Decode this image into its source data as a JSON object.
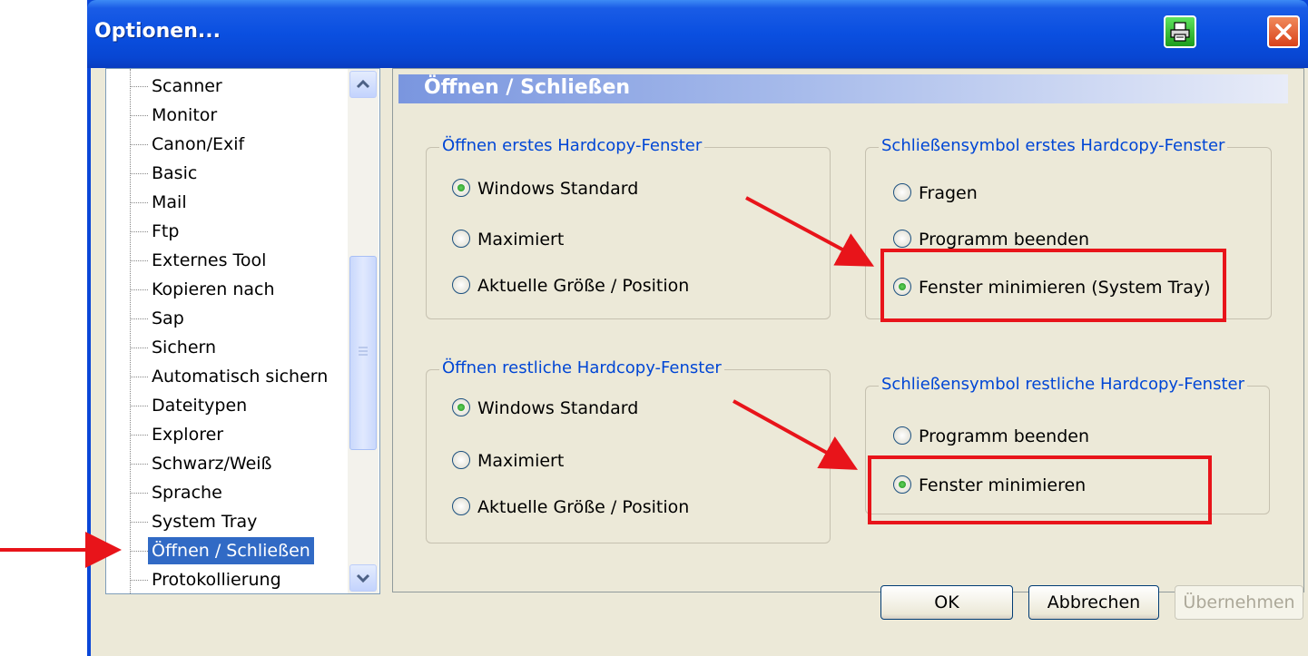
{
  "window": {
    "title": "Optionen..."
  },
  "tree": {
    "items": [
      "Scanner",
      "Monitor",
      "Canon/Exif",
      "Basic",
      "Mail",
      "Ftp",
      "Externes Tool",
      "Kopieren nach",
      "Sap",
      "Sichern",
      "Automatisch sichern",
      "Dateitypen",
      "Explorer",
      "Schwarz/Weiß",
      "Sprache",
      "System Tray",
      "Öffnen / Schließen",
      "Protokollierung"
    ],
    "selected": "Öffnen / Schließen"
  },
  "panel": {
    "title": "Öffnen / Schließen",
    "groups": {
      "open_first": {
        "title": "Öffnen erstes Hardcopy-Fenster",
        "options": [
          "Windows Standard",
          "Maximiert",
          "Aktuelle Größe / Position"
        ],
        "selected": "Windows Standard"
      },
      "close_first": {
        "title": "Schließensymbol erstes Hardcopy-Fenster",
        "options": [
          "Fragen",
          "Programm beenden",
          "Fenster minimieren (System Tray)"
        ],
        "selected": "Fenster minimieren (System Tray)"
      },
      "open_rest": {
        "title": "Öffnen restliche Hardcopy-Fenster",
        "options": [
          "Windows Standard",
          "Maximiert",
          "Aktuelle Größe / Position"
        ],
        "selected": "Windows Standard"
      },
      "close_rest": {
        "title": "Schließensymbol restliche Hardcopy-Fenster",
        "options": [
          "Programm beenden",
          "Fenster minimieren"
        ],
        "selected": "Fenster minimieren"
      }
    }
  },
  "buttons": {
    "ok": "OK",
    "cancel": "Abbrechen",
    "apply": "Übernehmen"
  },
  "icons": {
    "print": "printer-icon",
    "close": "close-icon"
  },
  "colors": {
    "accent_red": "#e8141a",
    "selection": "#316ac5",
    "group_title": "#0046d5"
  }
}
